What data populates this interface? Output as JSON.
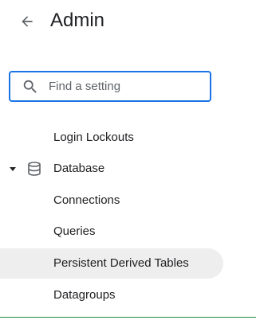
{
  "header": {
    "back_icon": "arrow-back-icon",
    "title": "Admin"
  },
  "search": {
    "icon": "search-icon",
    "placeholder": "Find a setting",
    "value": ""
  },
  "nav": {
    "items": [
      {
        "label": "Login Lockouts",
        "type": "child"
      },
      {
        "label": "Database",
        "type": "group",
        "expanded": true,
        "icon": "database-icon"
      },
      {
        "label": "Connections",
        "type": "child"
      },
      {
        "label": "Queries",
        "type": "child"
      },
      {
        "label": "Persistent Derived Tables",
        "type": "child",
        "selected": true
      },
      {
        "label": "Datagroups",
        "type": "child"
      }
    ]
  },
  "colors": {
    "focus_border": "#1a73e8",
    "selected_bg": "#eeeeee",
    "text": "#202124",
    "icon": "#5f6368"
  }
}
